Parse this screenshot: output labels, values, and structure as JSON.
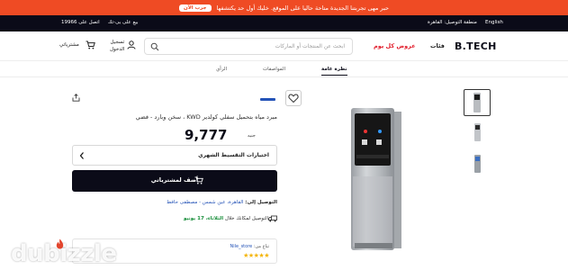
{
  "promo": {
    "text": "حبر مهى تجربتنا الجديدة متاحة حاليا على الموقع. خليك أول حد يكتشفها",
    "button": "جرب الآن"
  },
  "topbar": {
    "language": "English",
    "region": "منطقة التوصيل: القاهرة",
    "sell": "بيع على بى-تك",
    "hotline": "اتصل على 19966"
  },
  "header": {
    "logo": "B.TECH",
    "categories": "فئات",
    "offers": "عروض كل يوم",
    "search_placeholder": "ابحث عن المنتجات أو الماركات",
    "account_line1": "تسجيل",
    "account_line2": "الدخول",
    "cart_label": "مشترياتي"
  },
  "tabs": [
    {
      "label": "نظرة عامة",
      "active": true
    },
    {
      "label": "المواصفات",
      "active": false
    },
    {
      "label": "الرأي",
      "active": false
    }
  ],
  "product": {
    "title": "مبرد مياه بتحميل سفلي كولدير KWD ، سخن وبارد - فضي",
    "price": "9,777",
    "currency": "جنيه",
    "installments_label": "اختيارات التقسيط الشهري",
    "add_to_cart": "أضف لمشترياتي",
    "deliver_label": "التوصيل إلى:",
    "deliver_location": "القاهرة، عين شمس - مصطفى حافظ",
    "shipping_text": "التوصيل لمكانك خلال",
    "shipping_day": "الثلاثاء، 17 يونيو",
    "sold_by_label": "تباع من:",
    "seller": "Nile_store",
    "rating": 5,
    "stars": "★★★★★"
  },
  "watermark": "dubizzle",
  "colors": {
    "promo": "#ef4b24",
    "dark": "#0b0b18",
    "link": "#2453b7",
    "offer": "#e11d2b",
    "green": "#1a8f3c",
    "star": "#f4b400"
  }
}
